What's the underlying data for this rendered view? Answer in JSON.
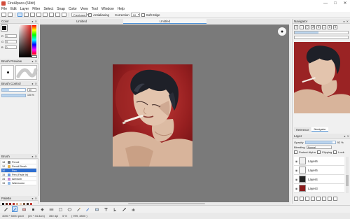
{
  "window": {
    "title": "FireAlpaca (64bit)"
  },
  "menu": [
    "File",
    "Edit",
    "Layer",
    "Filter",
    "Select",
    "Snap",
    "Color",
    "View",
    "Tool",
    "Window",
    "Help"
  ],
  "options": {
    "snap_mode": "Freehand",
    "antialiasing_label": "Antialiasing",
    "antialiasing_checked": true,
    "correction_label": "Correction",
    "correction_value": "10",
    "soft_edge_label": "Soft Edge",
    "soft_edge_checked": false
  },
  "canvas_tabs": [
    "Untitled",
    "Untitled"
  ],
  "color": {
    "title": "Color",
    "fg": "#111111",
    "bg": "#ffffff",
    "r_label": "R",
    "r": "0",
    "g_label": "G",
    "g": "0",
    "b_label": "B",
    "b": "0"
  },
  "brush_preview": {
    "title": "Brush Preview"
  },
  "brush_control": {
    "title": "Brush Control",
    "size": "30",
    "opacity": "100 %",
    "size_fraction": 0.3,
    "opacity_fraction": 1.0
  },
  "brush": {
    "title": "Brush",
    "items": [
      {
        "size": "18",
        "name": "Pencil",
        "color": "#777777"
      },
      {
        "size": "12",
        "name": "Pencil Brush",
        "color": "#e8b24a"
      },
      {
        "size": "10",
        "name": "Pen",
        "color": "#2f6fd0"
      },
      {
        "size": "15",
        "name": "Pen (Fade In)",
        "color": "#6a9be0"
      },
      {
        "size": "34",
        "name": "Airbrush",
        "color": "#c884d8"
      },
      {
        "size": "15",
        "name": "Watercolor",
        "color": "#8bb7e6"
      }
    ],
    "selected_index": 2
  },
  "palette": {
    "title": "Palette",
    "colors": [
      "#1a1a1a",
      "#5a2b1f",
      "#8c1b1c",
      "#b5302a",
      "#d9a98a",
      "#e8c8b0",
      "#7a5a45",
      "#3d2a25",
      "#c23b33",
      "#3a3a3a",
      "#6b3a2a",
      "#a12a2a",
      "#d04b3a",
      "#f0d8c6",
      "#ffffff",
      "#9b7a66",
      "#4e3a33",
      "#e2221b",
      "#555555",
      "#8a4a35",
      "#c34a3a",
      "#e06a50",
      "#f5e6da",
      "#dddddd",
      "#b58f7a",
      "#6a4a40",
      "#ff6b5a"
    ]
  },
  "navigator": {
    "title": "Navigator",
    "tools": [
      "+",
      "-",
      "◻",
      "↺",
      "↻",
      "⇔",
      "⇕",
      "✕"
    ],
    "zoom_fraction": 0.45,
    "tabs": [
      "Reference",
      "Navigator"
    ]
  },
  "layer": {
    "title": "Layer",
    "opacity_label": "Opacity",
    "opacity_value": "92 %",
    "blending_label": "Blending",
    "blending_value": "Normal",
    "protect_alpha_label": "Protect Alpha",
    "clipping_label": "Clipping",
    "lock_label": "Lock",
    "layers": [
      {
        "name": "Layer6",
        "thumb": "#f0f0f0"
      },
      {
        "name": "Layer5",
        "thumb": "#f6f6f6"
      },
      {
        "name": "Layer4",
        "thumb": "#222222"
      },
      {
        "name": "Layer3",
        "thumb": "#8c1b1c"
      }
    ]
  },
  "status": {
    "size": "4000 * 5000 pixel",
    "dimensions": "(20 * 34.3cm)",
    "dpi": "350 dpi",
    "zoom": "5 %",
    "coords": "( 999, 3800 )"
  }
}
